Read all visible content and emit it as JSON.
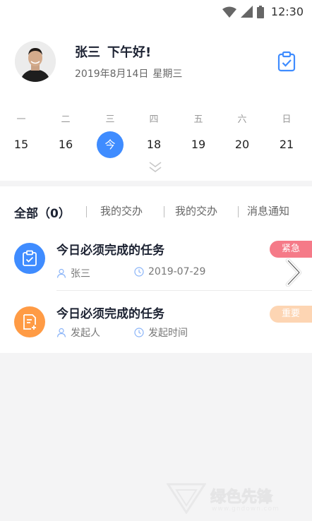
{
  "status_bar": {
    "time": "12:30"
  },
  "header": {
    "name": "张三",
    "greeting": "下午好!",
    "date": "2019年8月14日",
    "weekday": "星期三"
  },
  "calendar": {
    "weekdays": [
      "一",
      "二",
      "三",
      "四",
      "五",
      "六",
      "日"
    ],
    "days": [
      "15",
      "16",
      "今",
      "18",
      "19",
      "20",
      "21"
    ],
    "selected_index": 2
  },
  "tabs": [
    {
      "label": "全部（0）",
      "active": true
    },
    {
      "label": "我的交办",
      "active": false
    },
    {
      "label": "我的交办",
      "active": false
    },
    {
      "label": "消息通知",
      "active": false
    }
  ],
  "tasks": [
    {
      "title": "今日必须完成的任务",
      "person": "张三",
      "date": "2019-07-29",
      "badge": "紧急",
      "badge_color": "#f57a88",
      "icon": "clipboard-check-icon",
      "icon_color": "#3f8cff"
    },
    {
      "title": "今日必须完成的任务",
      "person": "发起人",
      "date": "发起时间",
      "badge": "重要",
      "badge_color": "#fdd5b3",
      "icon": "document-add-icon",
      "icon_color": "#ff9b45"
    }
  ],
  "colors": {
    "accent": "#3f8cff",
    "urgent": "#f57a88",
    "important": "#fdd5b3",
    "orange": "#ff9b45"
  },
  "watermark": {
    "text": "绿色先锋",
    "url": "www.gndown.com"
  }
}
